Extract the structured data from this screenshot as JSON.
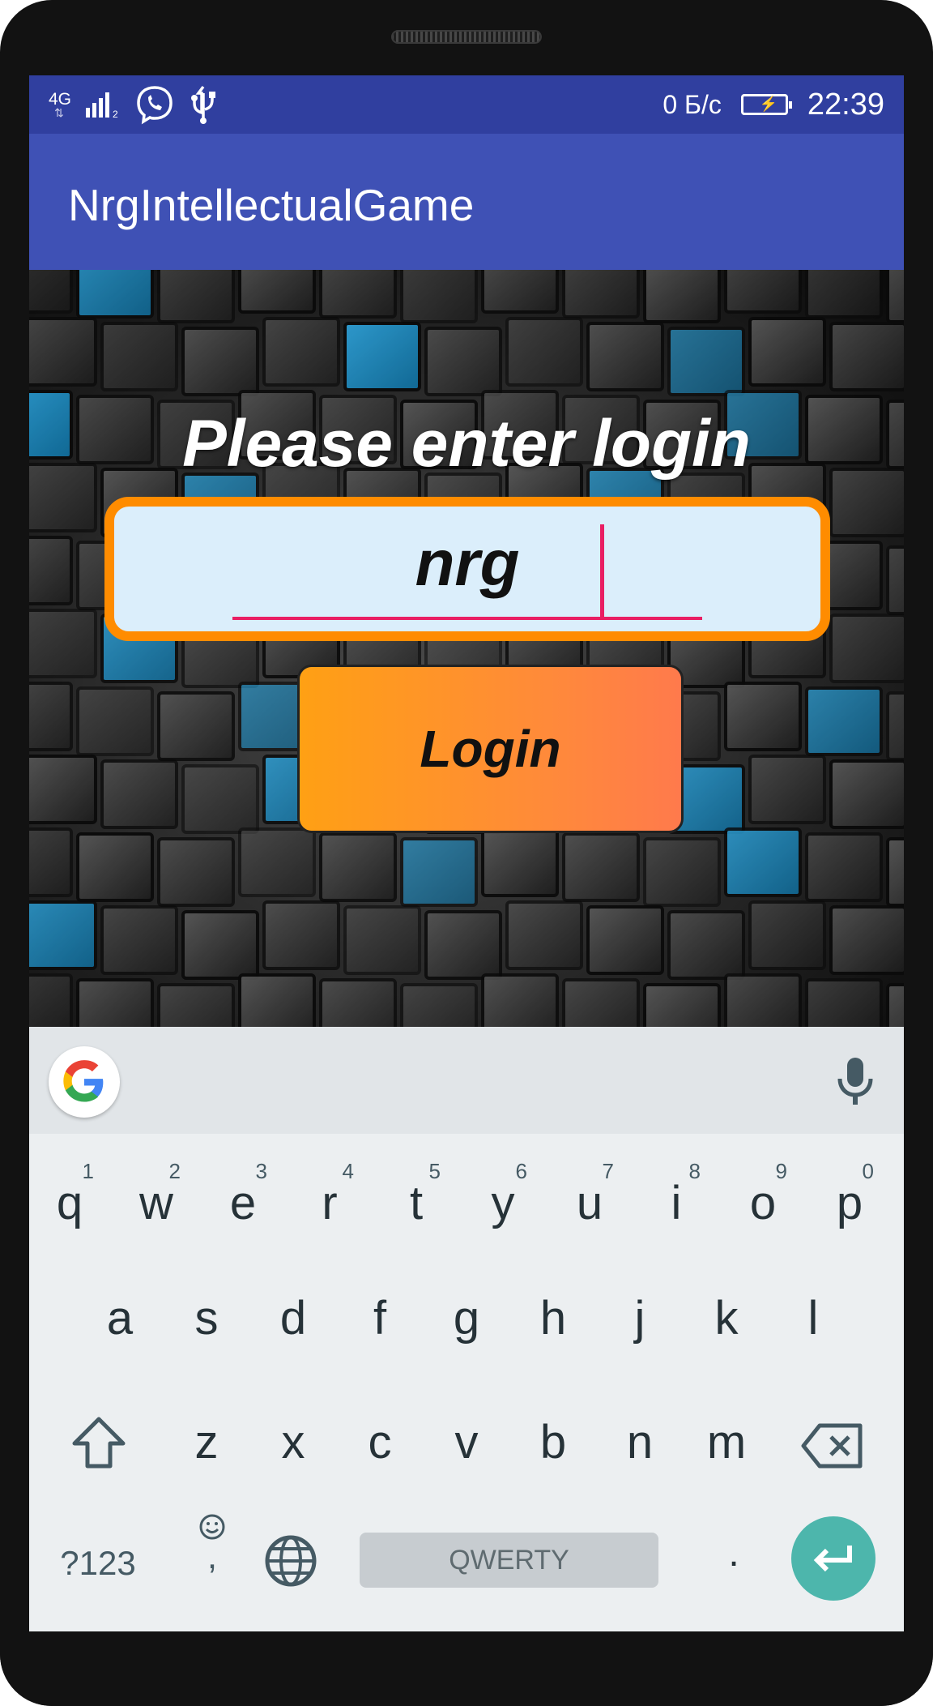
{
  "status_bar": {
    "network_type": "4G",
    "data_speed": "0 Б/с",
    "time": "22:39",
    "icons": [
      "network-4g-icon",
      "signal-icon",
      "viber-icon",
      "usb-icon",
      "battery-charging-icon"
    ]
  },
  "app_bar": {
    "title": "NrgIntellectualGame"
  },
  "login_screen": {
    "heading": "Please enter login",
    "login_value": "nrg",
    "button_label": "Login"
  },
  "keyboard": {
    "row1": [
      {
        "letter": "q",
        "hint": "1"
      },
      {
        "letter": "w",
        "hint": "2"
      },
      {
        "letter": "e",
        "hint": "3"
      },
      {
        "letter": "r",
        "hint": "4"
      },
      {
        "letter": "t",
        "hint": "5"
      },
      {
        "letter": "y",
        "hint": "6"
      },
      {
        "letter": "u",
        "hint": "7"
      },
      {
        "letter": "i",
        "hint": "8"
      },
      {
        "letter": "o",
        "hint": "9"
      },
      {
        "letter": "p",
        "hint": "0"
      }
    ],
    "row2": [
      "a",
      "s",
      "d",
      "f",
      "g",
      "h",
      "j",
      "k",
      "l"
    ],
    "row3": [
      "z",
      "x",
      "c",
      "v",
      "b",
      "n",
      "m"
    ],
    "symbols_key": "?123",
    "comma_key": ",",
    "period_key": ".",
    "space_label": "QWERTY",
    "icons": [
      "google-icon",
      "microphone-icon",
      "shift-icon",
      "backspace-icon",
      "emoji-icon",
      "globe-icon",
      "enter-icon"
    ]
  },
  "colors": {
    "status_bar": "#303f9f",
    "app_bar": "#3f51b5",
    "field_border": "#ff8c00",
    "field_background": "#dbeefb",
    "accent_cursor": "#e91e63",
    "button_gradient_start": "#ffa014",
    "button_gradient_end": "#ff7a4c",
    "enter_key": "#4db6ac"
  }
}
